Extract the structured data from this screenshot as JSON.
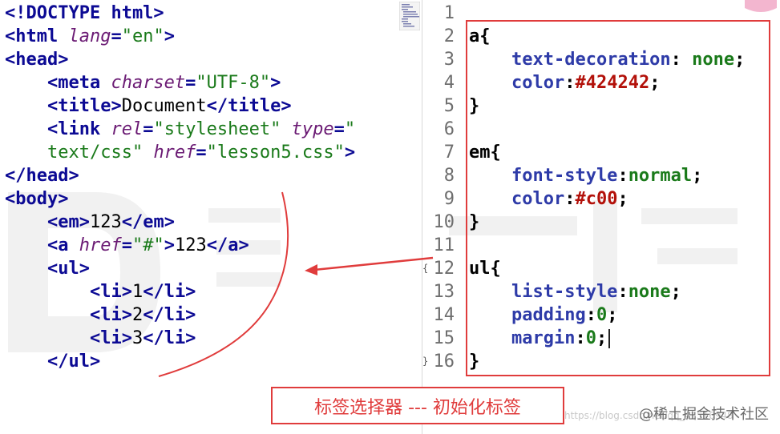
{
  "html_pane": {
    "lines": [
      [
        {
          "c": "tag",
          "t": "<!DOCTYPE html>"
        }
      ],
      [
        {
          "c": "tag",
          "t": "<html "
        },
        {
          "c": "attr",
          "t": "lang"
        },
        {
          "c": "tag",
          "t": "="
        },
        {
          "c": "str",
          "t": "\"en\""
        },
        {
          "c": "tag",
          "t": ">"
        }
      ],
      [
        {
          "c": "tag",
          "t": "<head>"
        }
      ],
      [
        {
          "c": "tag",
          "t": "    <meta "
        },
        {
          "c": "attr",
          "t": "charset"
        },
        {
          "c": "tag",
          "t": "="
        },
        {
          "c": "str",
          "t": "\"UTF-8\""
        },
        {
          "c": "tag",
          "t": ">"
        }
      ],
      [
        {
          "c": "tag",
          "t": "    <title>"
        },
        {
          "c": "txt",
          "t": "Document"
        },
        {
          "c": "tag",
          "t": "</title>"
        }
      ],
      [
        {
          "c": "tag",
          "t": "    <link "
        },
        {
          "c": "attr",
          "t": "rel"
        },
        {
          "c": "tag",
          "t": "="
        },
        {
          "c": "str",
          "t": "\"stylesheet\" "
        },
        {
          "c": "attr",
          "t": "type"
        },
        {
          "c": "tag",
          "t": "="
        },
        {
          "c": "str",
          "t": "\""
        }
      ],
      [
        {
          "c": "str",
          "t": "    text/css\" "
        },
        {
          "c": "attr",
          "t": "href"
        },
        {
          "c": "tag",
          "t": "="
        },
        {
          "c": "str",
          "t": "\"lesson5.css\""
        },
        {
          "c": "tag",
          "t": ">"
        }
      ],
      [
        {
          "c": "tag",
          "t": "</head>"
        }
      ],
      [
        {
          "c": "tag",
          "t": "<body>"
        }
      ],
      [
        {
          "c": "tag",
          "t": "    <em>"
        },
        {
          "c": "txt",
          "t": "123"
        },
        {
          "c": "tag",
          "t": "</em>"
        }
      ],
      [
        {
          "c": "tag",
          "t": "    <a "
        },
        {
          "c": "attr",
          "t": "href"
        },
        {
          "c": "tag",
          "t": "="
        },
        {
          "c": "str",
          "t": "\"#\""
        },
        {
          "c": "tag",
          "t": ">"
        },
        {
          "c": "txt",
          "t": "123"
        },
        {
          "c": "tag",
          "t": "</a>"
        }
      ],
      [
        {
          "c": "tag",
          "t": "    <ul>"
        }
      ],
      [
        {
          "c": "tag",
          "t": "        <li>"
        },
        {
          "c": "txt",
          "t": "1"
        },
        {
          "c": "tag",
          "t": "</li>"
        }
      ],
      [
        {
          "c": "tag",
          "t": "        <li>"
        },
        {
          "c": "txt",
          "t": "2"
        },
        {
          "c": "tag",
          "t": "</li>"
        }
      ],
      [
        {
          "c": "tag",
          "t": "        <li>"
        },
        {
          "c": "txt",
          "t": "3"
        },
        {
          "c": "tag",
          "t": "</li>"
        }
      ],
      [
        {
          "c": "tag",
          "t": "    </ul>"
        }
      ]
    ]
  },
  "css_pane": {
    "line_numbers": [
      "1",
      "2",
      "3",
      "4",
      "5",
      "6",
      "7",
      "8",
      "9",
      "10",
      "11",
      "12",
      "13",
      "14",
      "15",
      "16"
    ],
    "lines": [
      [],
      [
        {
          "c": "sel",
          "t": "a{"
        }
      ],
      [
        {
          "c": "prop",
          "t": "    text-decoration"
        },
        {
          "c": "punc",
          "t": ": "
        },
        {
          "c": "kw",
          "t": "none"
        },
        {
          "c": "punc",
          "t": ";"
        }
      ],
      [
        {
          "c": "prop",
          "t": "    color"
        },
        {
          "c": "punc",
          "t": ":"
        },
        {
          "c": "hex",
          "t": "#424242"
        },
        {
          "c": "punc",
          "t": ";"
        }
      ],
      [
        {
          "c": "sel",
          "t": "}"
        }
      ],
      [],
      [
        {
          "c": "sel",
          "t": "em{"
        }
      ],
      [
        {
          "c": "prop",
          "t": "    font-style"
        },
        {
          "c": "punc",
          "t": ":"
        },
        {
          "c": "kw",
          "t": "normal"
        },
        {
          "c": "punc",
          "t": ";"
        }
      ],
      [
        {
          "c": "prop",
          "t": "    color"
        },
        {
          "c": "punc",
          "t": ":"
        },
        {
          "c": "hex",
          "t": "#c00"
        },
        {
          "c": "punc",
          "t": ";"
        }
      ],
      [
        {
          "c": "sel",
          "t": "}"
        }
      ],
      [],
      [
        {
          "c": "sel",
          "t": "ul{"
        }
      ],
      [
        {
          "c": "prop",
          "t": "    list-style"
        },
        {
          "c": "punc",
          "t": ":"
        },
        {
          "c": "kw",
          "t": "none"
        },
        {
          "c": "punc",
          "t": ";"
        }
      ],
      [
        {
          "c": "prop",
          "t": "    padding"
        },
        {
          "c": "punc",
          "t": ":"
        },
        {
          "c": "num",
          "t": "0"
        },
        {
          "c": "punc",
          "t": ";"
        }
      ],
      [
        {
          "c": "prop",
          "t": "    margin"
        },
        {
          "c": "punc",
          "t": ":"
        },
        {
          "c": "num",
          "t": "0"
        },
        {
          "c": "punc",
          "t": ";"
        }
      ],
      [
        {
          "c": "sel",
          "t": "}"
        }
      ]
    ]
  },
  "annotation": {
    "caption": "标签选择器 --- 初始化标签"
  },
  "watermark": {
    "site": "@稀土掘金技术社区",
    "url": "https://blog.csdn.net/qq_41516948"
  },
  "colors": {
    "annotation_red": "#e03c3c",
    "tag_blue": "#0c0a94",
    "attr_purple": "#6b1b74",
    "string_green": "#1a7a1a",
    "hex_red": "#b3110a"
  }
}
